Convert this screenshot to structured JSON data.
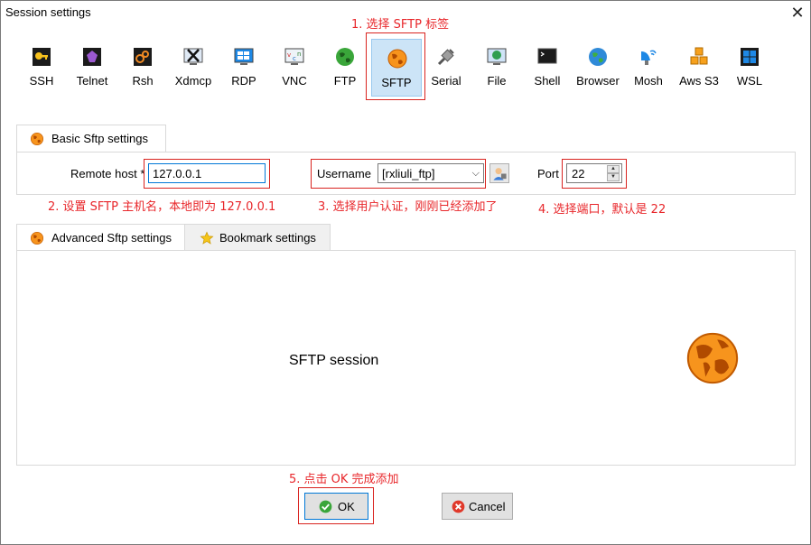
{
  "window": {
    "title": "Session settings"
  },
  "protocols": [
    {
      "label": "SSH",
      "icon": "key-icon"
    },
    {
      "label": "Telnet",
      "icon": "telnet-icon"
    },
    {
      "label": "Rsh",
      "icon": "rsh-icon"
    },
    {
      "label": "Xdmcp",
      "icon": "xdmcp-icon"
    },
    {
      "label": "RDP",
      "icon": "rdp-monitor-icon"
    },
    {
      "label": "VNC",
      "icon": "vnc-icon"
    },
    {
      "label": "FTP",
      "icon": "ftp-globe-icon"
    },
    {
      "label": "SFTP",
      "icon": "sftp-globe-icon",
      "selected": true
    },
    {
      "label": "Serial",
      "icon": "serial-plug-icon"
    },
    {
      "label": "File",
      "icon": "file-monitor-icon"
    },
    {
      "label": "Shell",
      "icon": "shell-terminal-icon"
    },
    {
      "label": "Browser",
      "icon": "browser-globe-icon"
    },
    {
      "label": "Mosh",
      "icon": "mosh-satellite-icon"
    },
    {
      "label": "Aws S3",
      "icon": "aws-cubes-icon"
    },
    {
      "label": "WSL",
      "icon": "windows-icon"
    }
  ],
  "annotations": {
    "a1": "1. 选择 SFTP 标签",
    "a2": "2. 设置 SFTP 主机名，本地即为 127.0.0.1",
    "a3": "3. 选择用户认证，刚刚已经添加了",
    "a4": "4. 选择端口，默认是 22",
    "a5": "5. 点击 OK 完成添加"
  },
  "basic_tab": {
    "label": "Basic Sftp settings"
  },
  "basic": {
    "remote_host_label": "Remote host",
    "remote_host_required": "*",
    "remote_host_value": "127.0.0.1",
    "username_label": "Username",
    "username_value": "[rxliuli_ftp]",
    "port_label": "Port",
    "port_value": "22"
  },
  "bottom_tabs": [
    {
      "label": "Advanced Sftp settings"
    },
    {
      "label": "Bookmark settings"
    }
  ],
  "session_label": "SFTP session",
  "buttons": {
    "ok": "OK",
    "cancel": "Cancel"
  },
  "colors": {
    "accent_red": "#d9231f",
    "selection": "#cce4f7",
    "sftp_orange": "#f7941d"
  }
}
